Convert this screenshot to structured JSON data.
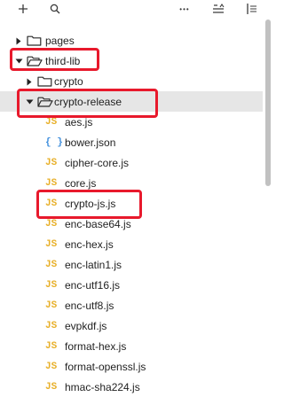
{
  "toolbar": {
    "buttons": [
      {
        "name": "add-icon",
        "glyph": "+"
      },
      {
        "name": "search-icon"
      },
      {
        "name": "more-icon",
        "glyph": "•••"
      },
      {
        "name": "sort-icon"
      },
      {
        "name": "collapse-icon"
      }
    ]
  },
  "tree": {
    "items": [
      {
        "label": "pages",
        "type": "folder",
        "depth": 0,
        "expanded": false
      },
      {
        "label": "third-lib",
        "type": "folder",
        "depth": 0,
        "expanded": true,
        "highlighted": true
      },
      {
        "label": "crypto",
        "type": "folder",
        "depth": 1,
        "expanded": false
      },
      {
        "label": "crypto-release",
        "type": "folder",
        "depth": 1,
        "expanded": true,
        "selected": true,
        "highlighted": true
      },
      {
        "label": "aes.js",
        "type": "js",
        "depth": 2
      },
      {
        "label": "bower.json",
        "type": "json",
        "depth": 2
      },
      {
        "label": "cipher-core.js",
        "type": "js",
        "depth": 2
      },
      {
        "label": "core.js",
        "type": "js",
        "depth": 2
      },
      {
        "label": "crypto-js.js",
        "type": "js",
        "depth": 2,
        "highlighted": true
      },
      {
        "label": "enc-base64.js",
        "type": "js",
        "depth": 2
      },
      {
        "label": "enc-hex.js",
        "type": "js",
        "depth": 2
      },
      {
        "label": "enc-latin1.js",
        "type": "js",
        "depth": 2
      },
      {
        "label": "enc-utf16.js",
        "type": "js",
        "depth": 2
      },
      {
        "label": "enc-utf8.js",
        "type": "js",
        "depth": 2
      },
      {
        "label": "evpkdf.js",
        "type": "js",
        "depth": 2
      },
      {
        "label": "format-hex.js",
        "type": "js",
        "depth": 2
      },
      {
        "label": "format-openssl.js",
        "type": "js",
        "depth": 2
      },
      {
        "label": "hmac-sha224.js",
        "type": "js",
        "depth": 2
      }
    ]
  },
  "icons": {
    "js": "JS",
    "json": "{ }"
  },
  "colors": {
    "highlight": "#e8192c",
    "selection": "#e6e6e6",
    "js_icon": "#e8b02a",
    "json_icon": "#3f8fdd",
    "scrollbar": "#c1c1c1"
  }
}
